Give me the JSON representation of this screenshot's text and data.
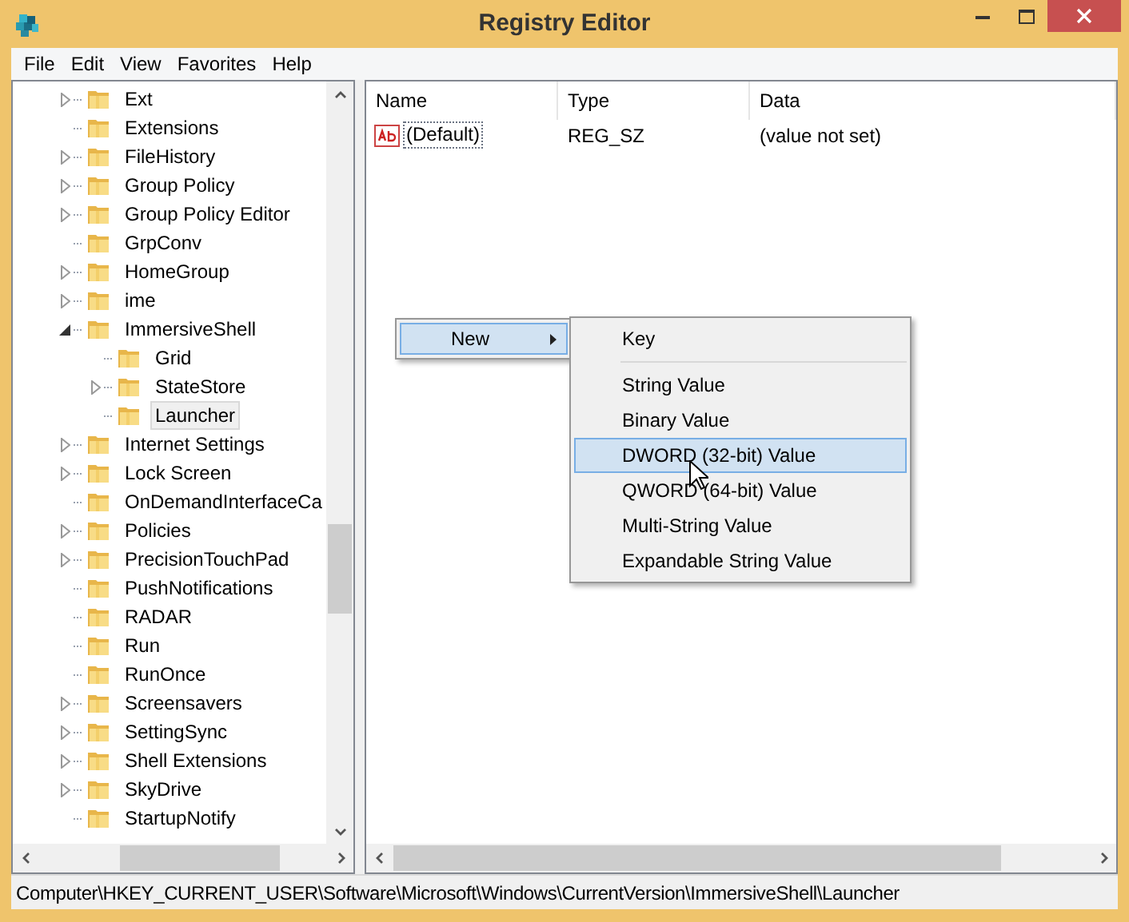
{
  "window": {
    "title": "Registry Editor"
  },
  "menu_bar": [
    "File",
    "Edit",
    "View",
    "Favorites",
    "Help"
  ],
  "tree": [
    {
      "label": "Ext",
      "has_children": true,
      "expanded": false,
      "selected": false
    },
    {
      "label": "Extensions",
      "has_children": false,
      "selected": false
    },
    {
      "label": "FileHistory",
      "has_children": true,
      "expanded": false,
      "selected": false
    },
    {
      "label": "Group Policy",
      "has_children": true,
      "expanded": false,
      "selected": false
    },
    {
      "label": "Group Policy Editor",
      "has_children": true,
      "expanded": false,
      "selected": false
    },
    {
      "label": "GrpConv",
      "has_children": false,
      "selected": false
    },
    {
      "label": "HomeGroup",
      "has_children": true,
      "expanded": false,
      "selected": false
    },
    {
      "label": "ime",
      "has_children": true,
      "expanded": false,
      "selected": false
    },
    {
      "label": "ImmersiveShell",
      "has_children": true,
      "expanded": true,
      "selected": false,
      "children": [
        {
          "label": "Grid",
          "has_children": false,
          "selected": false
        },
        {
          "label": "StateStore",
          "has_children": true,
          "expanded": false,
          "selected": false
        },
        {
          "label": "Launcher",
          "has_children": false,
          "selected": true
        }
      ]
    },
    {
      "label": "Internet Settings",
      "has_children": true,
      "expanded": false,
      "selected": false
    },
    {
      "label": "Lock Screen",
      "has_children": true,
      "expanded": false,
      "selected": false
    },
    {
      "label": "OnDemandInterfaceCa",
      "has_children": false,
      "selected": false
    },
    {
      "label": "Policies",
      "has_children": true,
      "expanded": false,
      "selected": false
    },
    {
      "label": "PrecisionTouchPad",
      "has_children": true,
      "expanded": false,
      "selected": false
    },
    {
      "label": "PushNotifications",
      "has_children": false,
      "selected": false
    },
    {
      "label": "RADAR",
      "has_children": false,
      "selected": false
    },
    {
      "label": "Run",
      "has_children": false,
      "selected": false
    },
    {
      "label": "RunOnce",
      "has_children": false,
      "selected": false
    },
    {
      "label": "Screensavers",
      "has_children": true,
      "expanded": false,
      "selected": false
    },
    {
      "label": "SettingSync",
      "has_children": true,
      "expanded": false,
      "selected": false
    },
    {
      "label": "Shell Extensions",
      "has_children": true,
      "expanded": false,
      "selected": false
    },
    {
      "label": "SkyDrive",
      "has_children": true,
      "expanded": false,
      "selected": false
    },
    {
      "label": "StartupNotify",
      "has_children": false,
      "selected": false
    }
  ],
  "values_table": {
    "columns": [
      "Name",
      "Type",
      "Data"
    ],
    "rows": [
      {
        "name": "(Default)",
        "type": "REG_SZ",
        "data": "(value not set)"
      }
    ]
  },
  "context_menu": {
    "items": [
      {
        "label": "New",
        "selected": true
      }
    ],
    "submenu": [
      {
        "label": "Key",
        "selected": false,
        "separator_after": true
      },
      {
        "label": "String Value",
        "selected": false,
        "separator_after": false
      },
      {
        "label": "Binary Value",
        "selected": false,
        "separator_after": false
      },
      {
        "label": "DWORD (32-bit) Value",
        "selected": true,
        "separator_after": false
      },
      {
        "label": "QWORD (64-bit) Value",
        "selected": false,
        "separator_after": false
      },
      {
        "label": "Multi-String Value",
        "selected": false,
        "separator_after": false
      },
      {
        "label": "Expandable String Value",
        "selected": false,
        "separator_after": false
      }
    ]
  },
  "status_bar": "Computer\\HKEY_CURRENT_USER\\Software\\Microsoft\\Windows\\CurrentVersion\\ImmersiveShell\\Launcher"
}
